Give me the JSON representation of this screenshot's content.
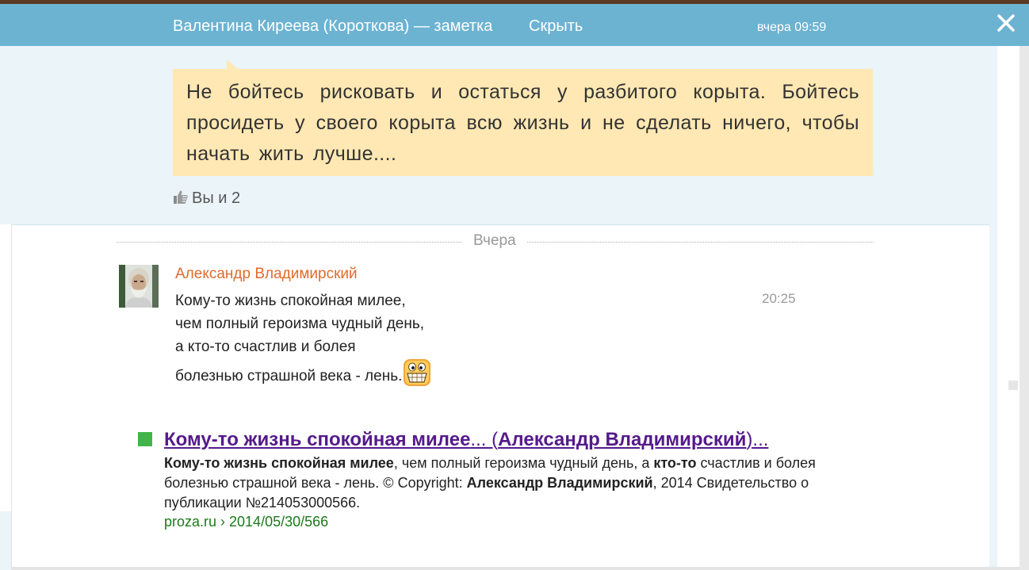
{
  "header": {
    "title": "Валентина Киреева (Короткова) — заметка",
    "hide_label": "Скрыть",
    "timestamp": "вчера 09:59",
    "close_icon": "close-icon"
  },
  "note": {
    "text": "Не бойтесь рисковать и остаться у разбитого корыта. Бойтесь просидеть у своего корыта всю жизнь и не сделать ничего, чтобы начать жить лучше....",
    "likes_icon": "thumbs-up-icon",
    "likes_text": "Вы и 2"
  },
  "feed": {
    "divider_label": "Вчера"
  },
  "comment": {
    "author": "Александр Владимирский",
    "time": "20:25",
    "lines": [
      "Кому-то жизнь спокойная милее,",
      "чем полный героизма чудный день,",
      "а кто-то счастлив и болея",
      "болезнью страшной века - лень."
    ],
    "avatar_icon": "avatar",
    "emoji_icon": "grinning-smiley-icon"
  },
  "search_result": {
    "title_part1": "Кому-то жизнь спокойная милее",
    "title_part2": "... (",
    "title_part3": "Александр Владимирский",
    "title_part4": ")...",
    "snippet": {
      "s1": "Кому-то жизнь спокойная милее",
      "s2": ", чем полный героизма чудный день, а ",
      "s3": "кто-то",
      "s4": " счастлив и болея болезнью страшной века - лень. © Copyright: ",
      "s5": "Александр Владимирский",
      "s6": ", 2014 Свидетельство о публикации №214053000566."
    },
    "url": "proza.ru › 2014/05/30/566"
  },
  "colors": {
    "header_bg": "#6cb3d2",
    "note_bg": "#ffe8b3",
    "panel_bg": "#ebf4f9",
    "author": "#e06a2c",
    "link": "#551a8b",
    "url": "#1a7a1a"
  }
}
